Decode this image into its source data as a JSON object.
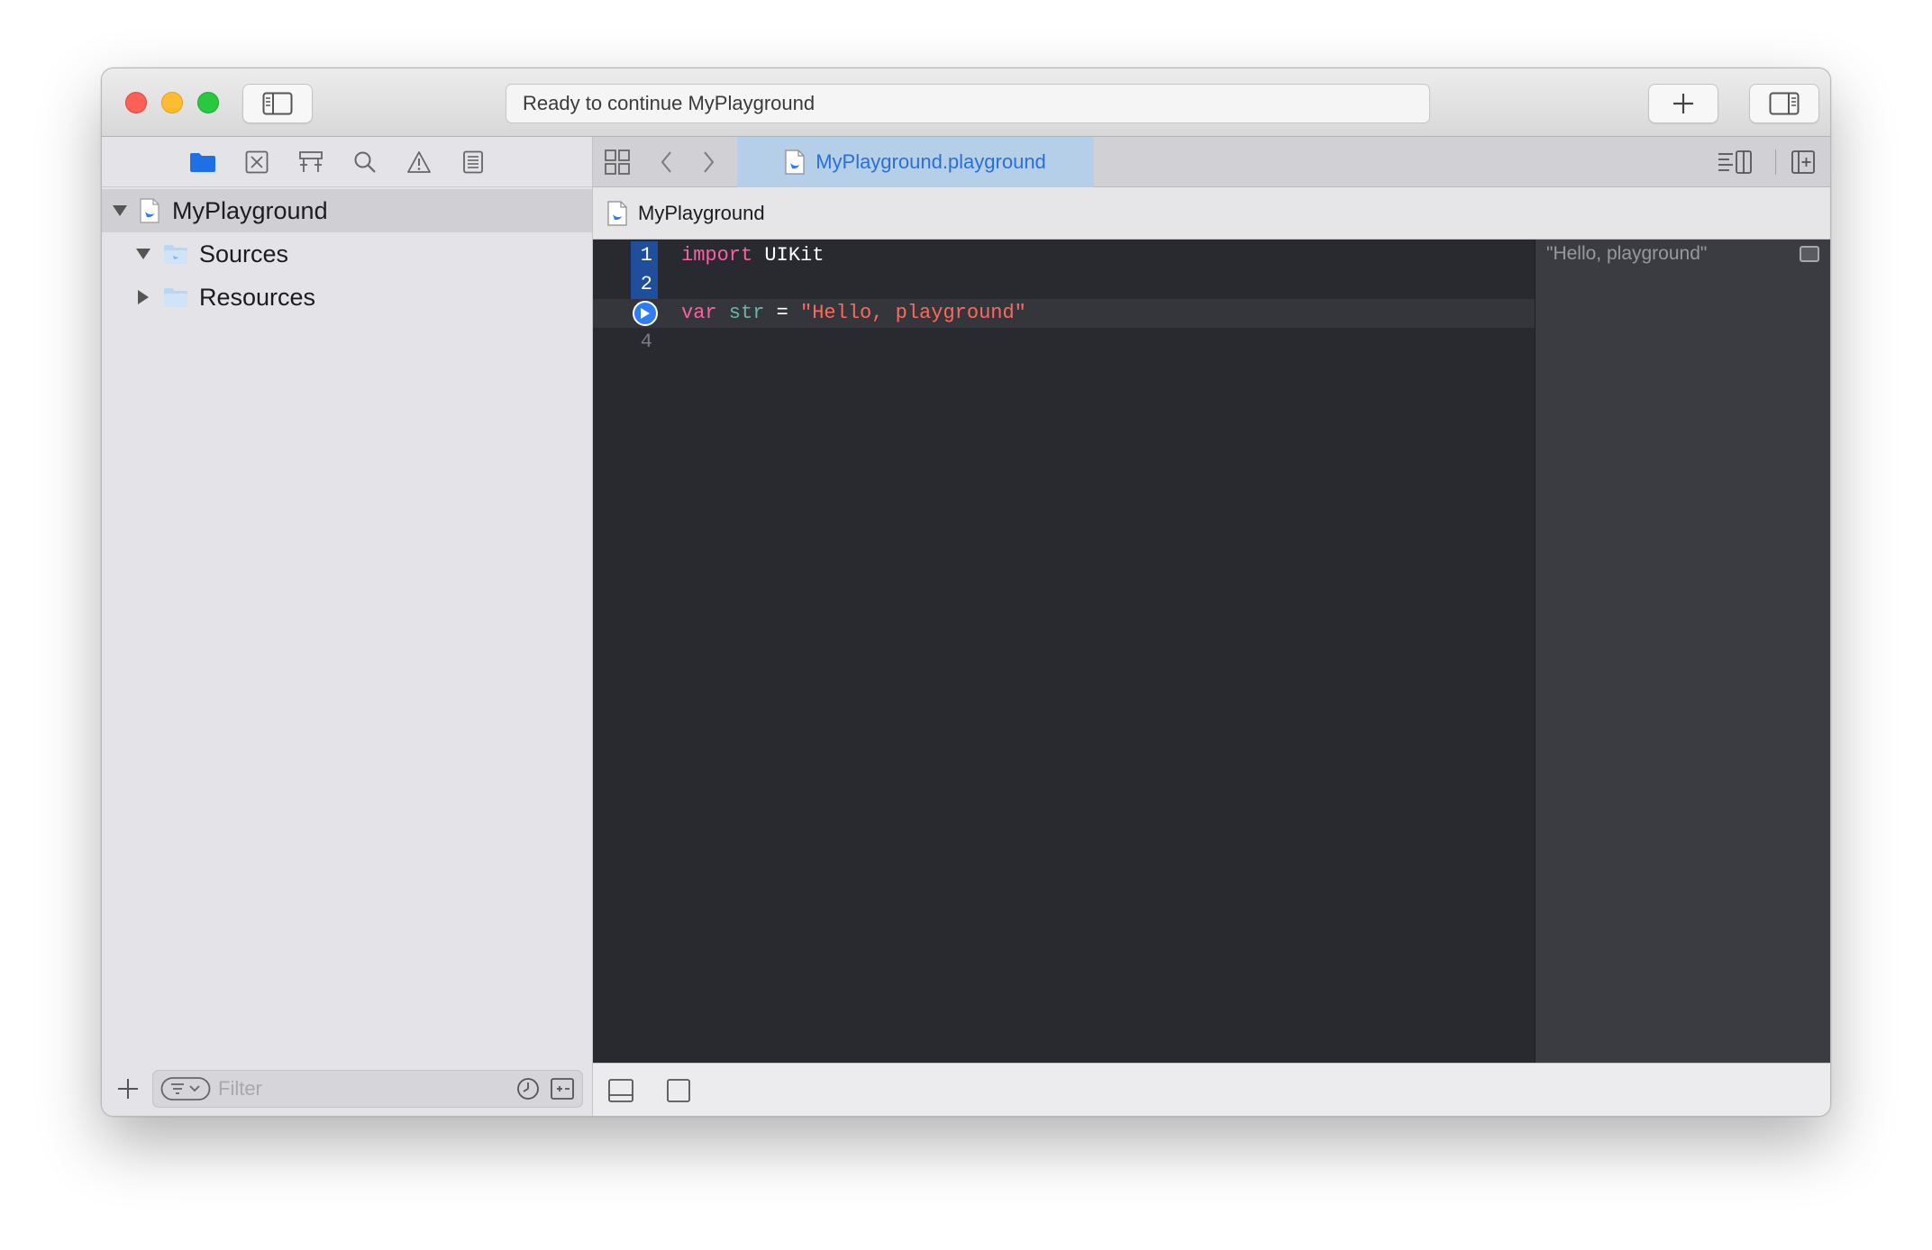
{
  "window": {
    "activity_text": "Ready to continue MyPlayground"
  },
  "navigator": {
    "toolbar_icons": [
      "folder-icon",
      "source-control-icon",
      "symbol-icon",
      "search-icon",
      "warning-icon",
      "report-icon"
    ],
    "tree": [
      {
        "label": "MyPlayground",
        "expanded": true,
        "selected": true,
        "icon": "swift-file-icon"
      },
      {
        "label": "Sources",
        "expanded": true,
        "icon": "folder-icon"
      },
      {
        "label": "Resources",
        "expanded": false,
        "icon": "folder-icon"
      }
    ],
    "filter": {
      "placeholder": "Filter",
      "value": ""
    }
  },
  "editor": {
    "tab_label": "MyPlayground.playground",
    "jumpbar_label": "MyPlayground",
    "lines": [
      {
        "number": "1",
        "tokens": [
          {
            "text": "import",
            "kind": "kw"
          },
          {
            "text": " UIKit",
            "kind": "plain"
          }
        ]
      },
      {
        "number": "2",
        "tokens": []
      },
      {
        "number": "3",
        "tokens": [
          {
            "text": "var",
            "kind": "kw"
          },
          {
            "text": " str",
            "kind": "ident"
          },
          {
            "text": " = ",
            "kind": "plain"
          },
          {
            "text": "\"Hello, playground\"",
            "kind": "str"
          }
        ]
      },
      {
        "number": "4",
        "tokens": []
      }
    ],
    "result": "\"Hello, playground\""
  },
  "colors": {
    "editor_background": "#292a30",
    "results_background": "#3b3c42",
    "keyword": "#fc5fa3",
    "string": "#fc6a5d",
    "identifier": "#67b7a4",
    "accent": "#2f7cf6"
  }
}
